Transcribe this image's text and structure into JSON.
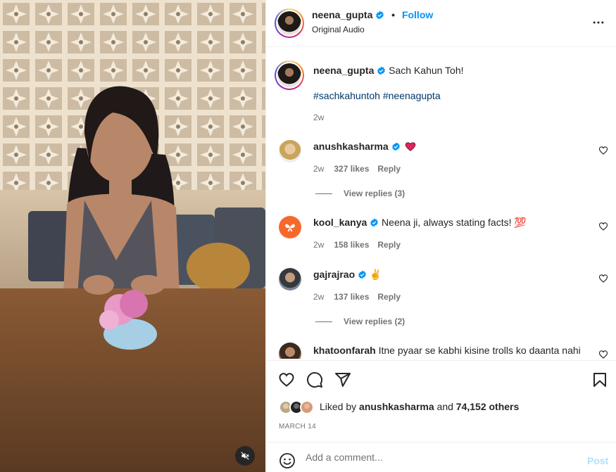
{
  "header": {
    "username": "neena_gupta",
    "separator": "•",
    "follow_label": "Follow",
    "audio": "Original Audio"
  },
  "caption": {
    "username": "neena_gupta",
    "text": "Sach Kahun Toh!",
    "hashtags": "#sachkahuntoh #neenagupta",
    "time": "2w"
  },
  "comments": [
    {
      "username": "anushkasharma",
      "text": "",
      "emoji": "heart-emoji",
      "time": "2w",
      "likes": "327 likes",
      "reply": "Reply",
      "view_replies": "View replies (3)"
    },
    {
      "username": "kool_kanya",
      "text": "Neena ji, always stating facts! 💯",
      "emoji": "",
      "time": "2w",
      "likes": "158 likes",
      "reply": "Reply"
    },
    {
      "username": "gajrajrao",
      "text": "✌️",
      "emoji": "victory-hand-emoji",
      "time": "2w",
      "likes": "137 likes",
      "reply": "Reply",
      "view_replies": "View replies (2)"
    },
    {
      "username": "khatoonfarah",
      "text": "Itne pyaar se kabhi kisine trolls ko daanta nahi"
    }
  ],
  "likes": {
    "prefix": "Liked by",
    "user": "anushkasharma",
    "middle": "and",
    "count": "74,152 others"
  },
  "date": "MARCH 14",
  "add_comment": {
    "placeholder": "Add a comment...",
    "post_label": "Post"
  },
  "colors": {
    "link_blue": "#0095f6",
    "hashtag": "#00376b",
    "post_disabled": "#b2dffc",
    "secondary_text": "#737373"
  },
  "icons": [
    "verified-badge-icon",
    "more-options-icon",
    "heart-icon",
    "comment-icon",
    "share-icon",
    "bookmark-icon",
    "emoji-icon",
    "muted-speaker-icon"
  ]
}
